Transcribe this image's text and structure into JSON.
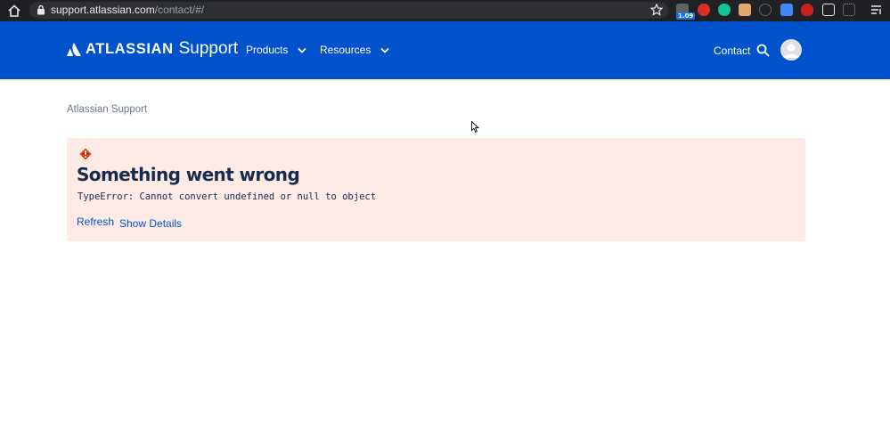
{
  "browser": {
    "url_host": "support.atlassian.com",
    "url_path": "/contact/#/",
    "extension_badge": "1.09"
  },
  "header": {
    "logo_word": "ATLASSIAN",
    "logo_product": "Support",
    "nav": [
      {
        "label": "Products"
      },
      {
        "label": "Resources"
      }
    ],
    "contact_label": "Contact",
    "brand_color": "#0052cc"
  },
  "breadcrumb": "Atlassian Support",
  "error": {
    "title": "Something went wrong",
    "message": "TypeError: Cannot convert undefined or null to object",
    "refresh_label": "Refresh",
    "separator": "·",
    "details_label": "Show Details",
    "panel_color": "#ffebe6",
    "icon_color": "#de350b"
  }
}
